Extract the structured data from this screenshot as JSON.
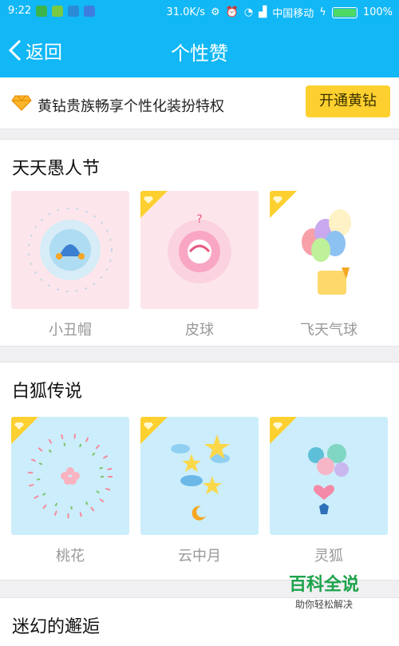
{
  "status_bar": {
    "time": "9:22",
    "speed": "31.0K/s",
    "carrier": "中国移动",
    "battery": "100%"
  },
  "nav": {
    "back_label": "返回",
    "title": "个性赞"
  },
  "promo": {
    "text": "黄钻贵族畅享个性化装扮特权",
    "button": "开通黄钻"
  },
  "sections": [
    {
      "title": "天天愚人节",
      "items": [
        "小丑帽",
        "皮球",
        "飞天气球"
      ]
    },
    {
      "title": "白狐传说",
      "items": [
        "桃花",
        "云中月",
        "灵狐"
      ]
    },
    {
      "title": "迷幻的邂逅"
    }
  ],
  "watermark": {
    "title": "百科全说",
    "subtitle": "助你轻松解决"
  },
  "colors": {
    "header": "#12b7f5",
    "vip_gold": "#fdd02f"
  }
}
